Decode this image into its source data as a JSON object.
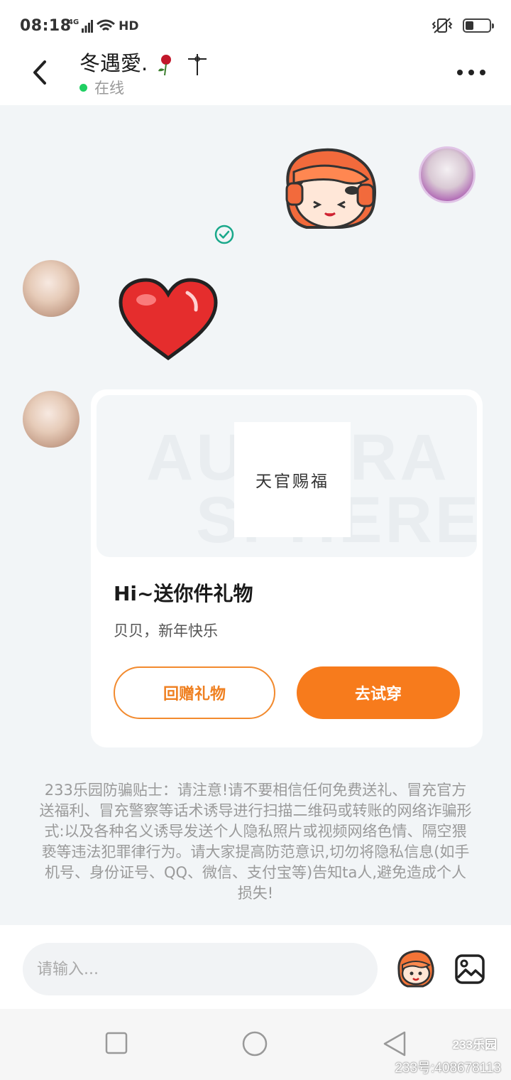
{
  "status_bar": {
    "time": "08:18",
    "network": "4G",
    "wifi_label": "HD",
    "battery_level": 0.35
  },
  "header": {
    "contact_name": "冬遇愛.",
    "presence": "在线",
    "back_icon": "chevron-left-icon",
    "more_icon": "more-horizontal-icon"
  },
  "gift_card": {
    "watermark_line1": "AURORA",
    "watermark_line2": "SPHERE",
    "item_label": "天官赐福",
    "title": "Hi~送你件礼物",
    "message": "贝贝，新年快乐",
    "return_label": "回赠礼物",
    "try_on_label": "去试穿"
  },
  "warning_text": "233乐园防骗贴士：请注意!请不要相信任何免费送礼、冒充官方送福利、冒充警察等话术诱导进行扫描二维码或转账的网络诈骗形式:以及各种名义诱导发送个人隐私照片或视频网络色情、隔空猥亵等违法犯罪律行为。请大家提高防范意识,切勿将隐私信息(如手机号、身份证号、QQ、微信、支付宝等)告知ta人,避免造成个人损失!",
  "input": {
    "placeholder": "请输入..."
  },
  "footer": {
    "logo": "233乐园",
    "watermark": "233号:408678113"
  },
  "colors": {
    "accent": "#f77b1c",
    "online": "#1fcf62",
    "read_check": "#19a88a"
  }
}
